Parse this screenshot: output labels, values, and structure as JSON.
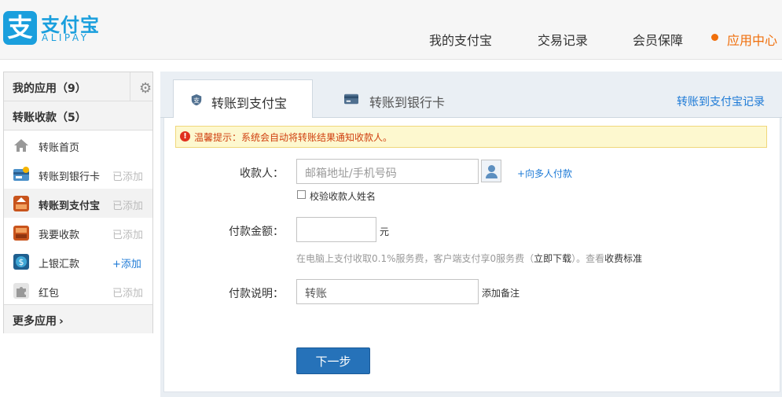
{
  "brand": {
    "name_cn": "支付宝",
    "name_en": "ALIPAY",
    "logo_char": "支",
    "color": "#1a9fdd"
  },
  "nav": [
    "我的支付宝",
    "交易记录",
    "会员保障",
    "应用中心"
  ],
  "nav_active": "应用中心",
  "accent_color": "#f06f0c",
  "sidebar": {
    "my_apps": "我的应用（9）",
    "group_title": "转账收款（5）",
    "items": [
      {
        "label": "转账首页",
        "action": "",
        "icon": "home-icon"
      },
      {
        "label": "转账到银行卡",
        "action": "已添加",
        "icon": "bank-card-icon"
      },
      {
        "label": "转账到支付宝",
        "action": "已添加",
        "icon": "alipay-transfer-icon"
      },
      {
        "label": "我要收款",
        "action": "已添加",
        "icon": "collect-money-icon"
      },
      {
        "label": "上银汇款",
        "action": "+添加",
        "icon": "remittance-icon"
      },
      {
        "label": "红包",
        "action": "已添加",
        "icon": "puzzle-icon"
      }
    ],
    "more": "更多应用"
  },
  "tabs": [
    {
      "label": "转账到支付宝",
      "active": true
    },
    {
      "label": "转账到银行卡",
      "active": false
    }
  ],
  "record_link": "转账到支付宝记录",
  "tip": "温馨提示：系统会自动将转账结果通知收款人。",
  "form": {
    "payee_label": "收款人：",
    "payee_placeholder": "邮箱地址/手机号码",
    "multi_payee": "+向多人付款",
    "verify_name": "校验收款人姓名",
    "amount_label": "付款金额：",
    "amount_unit": "元",
    "fee_note_prefix": "在电脑上支付收取0.1%服务费，客户端支付享0服务费（",
    "fee_download": "立即下载",
    "fee_note_mid": "）。查看",
    "fee_standard": "收费标准",
    "memo_label": "付款说明：",
    "memo_value": "转账",
    "add_note": "添加备注",
    "next_button": "下一步"
  }
}
